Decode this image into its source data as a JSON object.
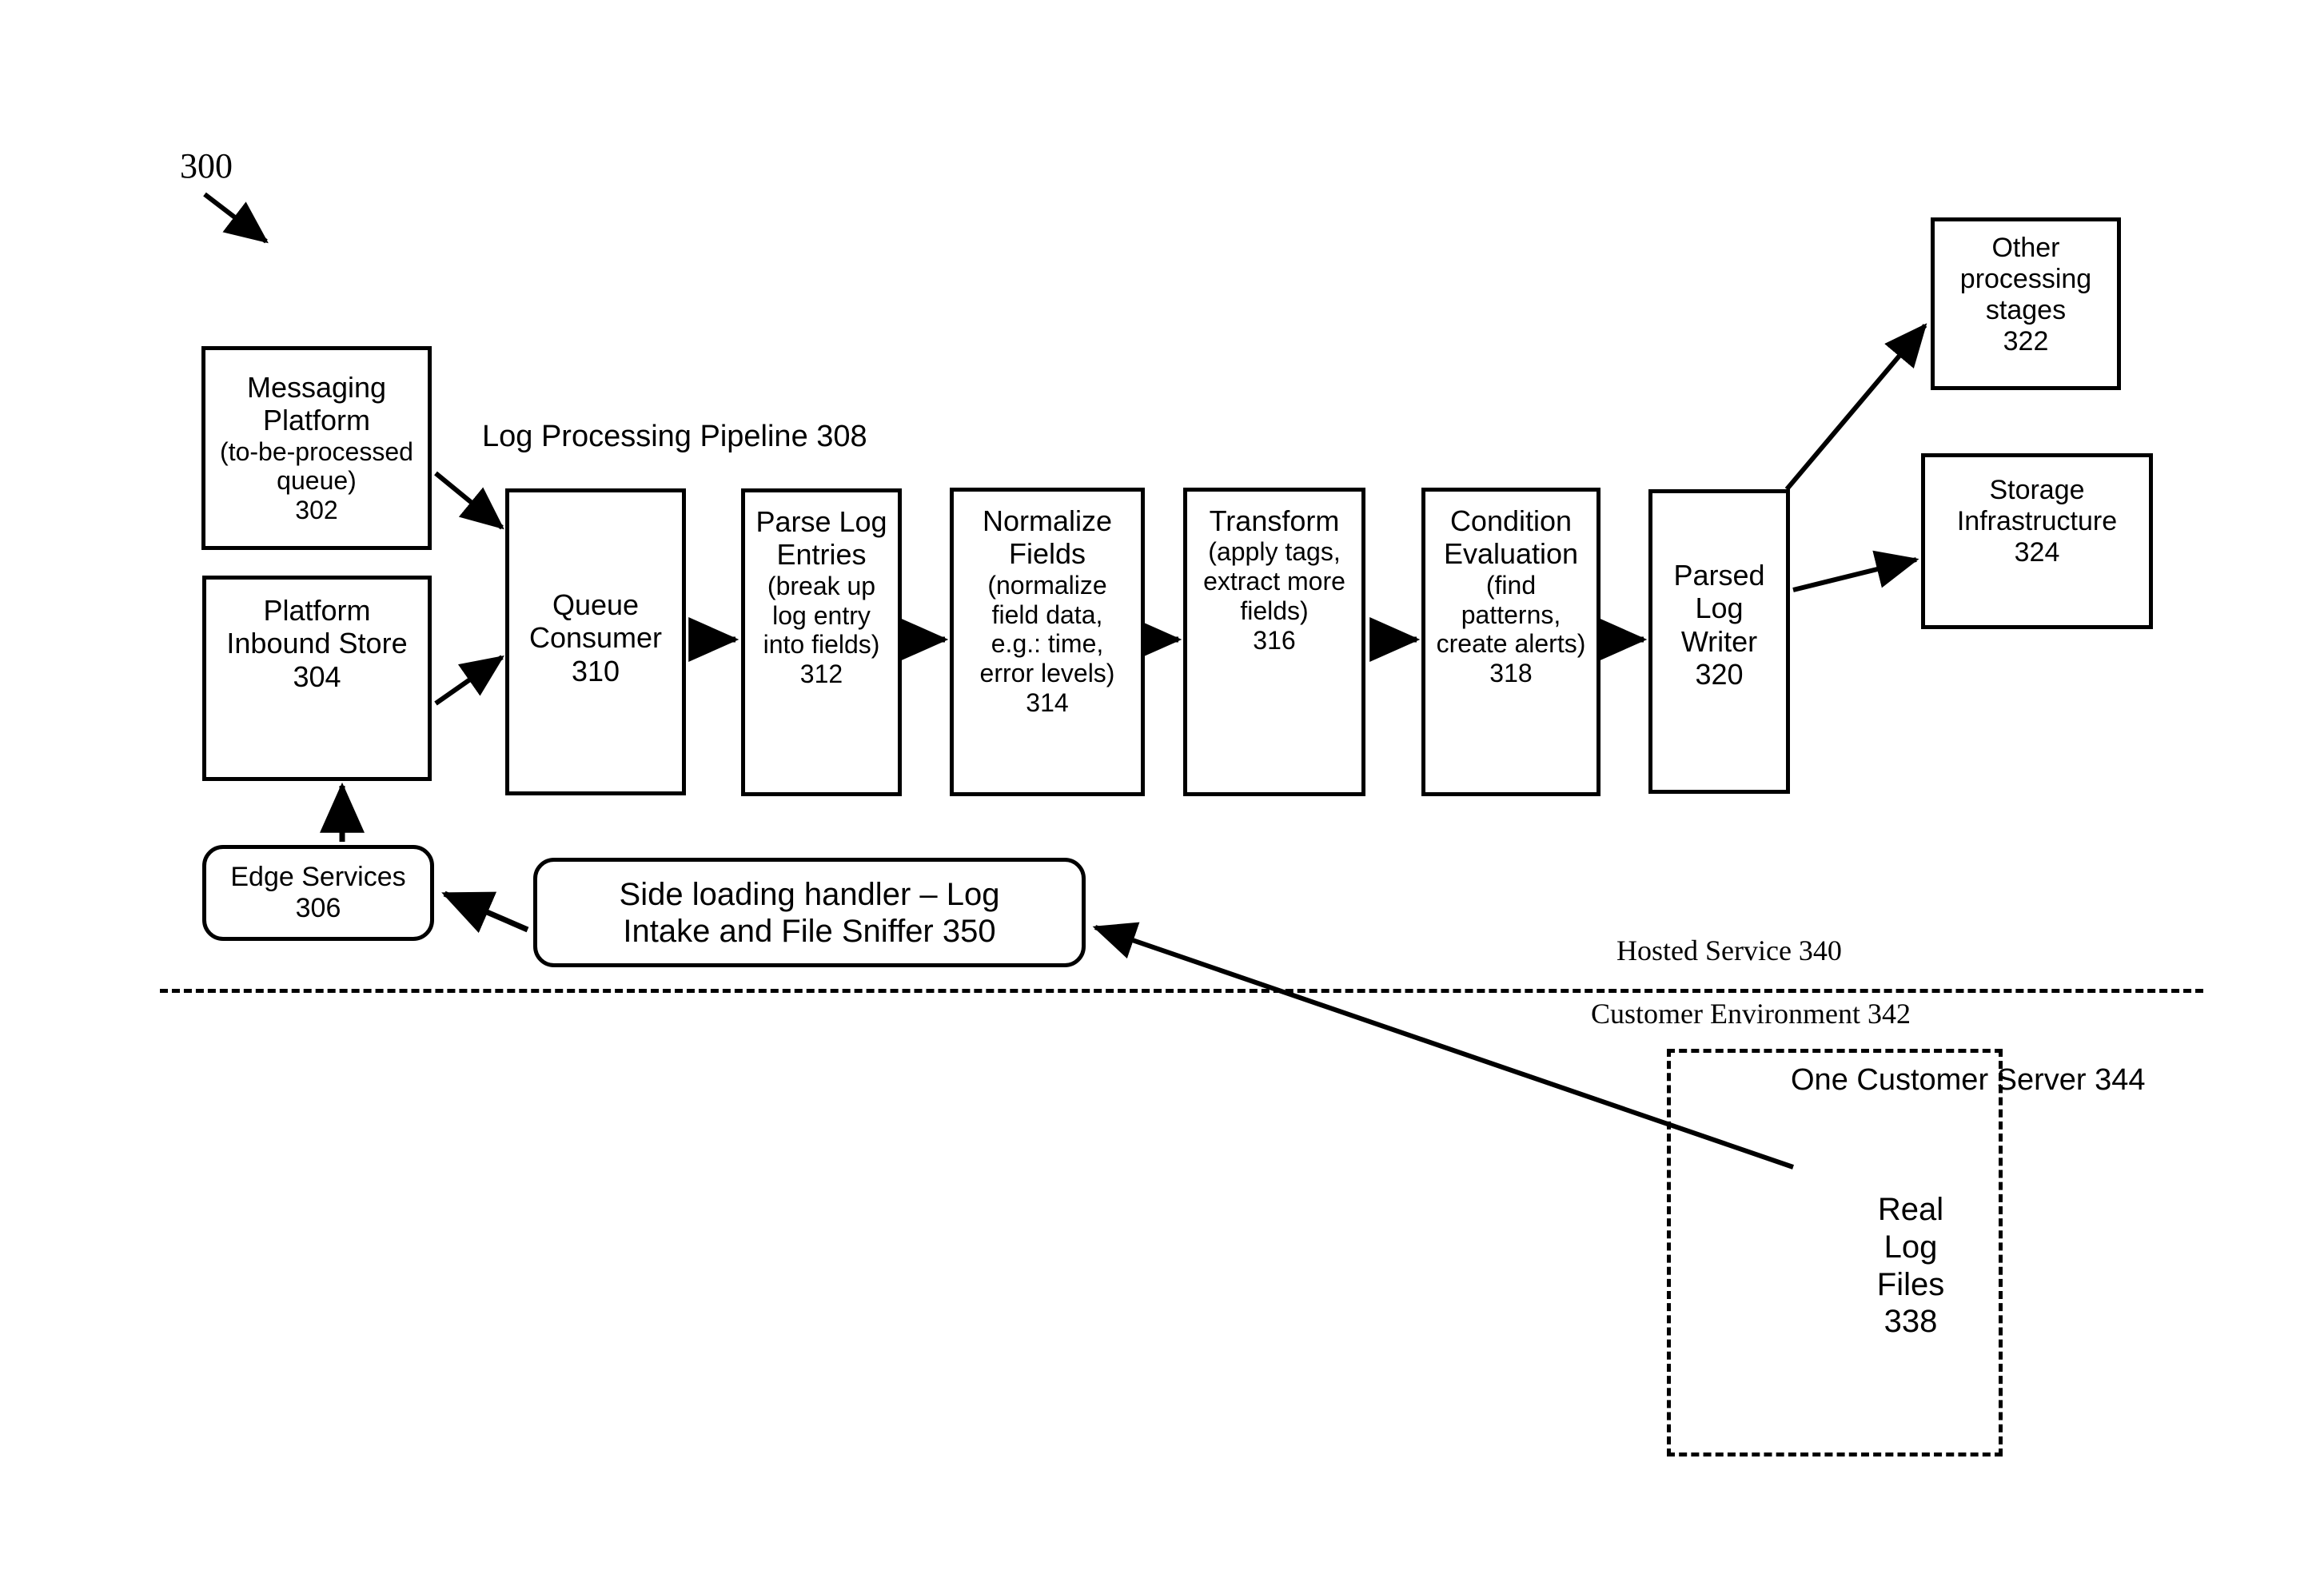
{
  "figure": {
    "number": "300"
  },
  "labels": {
    "pipeline": "Log Processing Pipeline 308",
    "hosted_service": "Hosted Service 340",
    "customer_environment": "Customer Environment 342",
    "customer_server": "One Customer Server 344"
  },
  "nodes": {
    "messaging_platform": {
      "line1": "Messaging",
      "line2": "Platform",
      "line3": "(to-be-processed",
      "line4": "queue)",
      "ref": "302"
    },
    "platform_inbound_store": {
      "line1": "Platform",
      "line2": "Inbound Store",
      "ref": "304"
    },
    "edge_services": {
      "line1": "Edge Services",
      "ref": "306"
    },
    "queue_consumer": {
      "line1": "Queue",
      "line2": "Consumer",
      "ref": "310"
    },
    "parse_log_entries": {
      "line1": "Parse Log",
      "line2": "Entries",
      "line3": "(break up",
      "line4": "log entry",
      "line5": "into fields)",
      "ref": "312"
    },
    "normalize_fields": {
      "line1": "Normalize",
      "line2": "Fields",
      "line3": "(normalize",
      "line4": "field data,",
      "line5": "e.g.: time,",
      "line6": "error levels)",
      "ref": "314"
    },
    "transform": {
      "line1": "Transform",
      "line2": "(apply tags,",
      "line3": "extract more",
      "line4": "fields)",
      "ref": "316"
    },
    "condition_evaluation": {
      "line1": "Condition",
      "line2": "Evaluation",
      "line3": "(find",
      "line4": "patterns,",
      "line5": "create alerts)",
      "ref": "318"
    },
    "parsed_log_writer": {
      "line1": "Parsed",
      "line2": "Log",
      "line3": "Writer",
      "ref": "320"
    },
    "other_processing_stages": {
      "line1": "Other",
      "line2": "processing",
      "line3": "stages",
      "ref": "322"
    },
    "storage_infrastructure": {
      "line1": "Storage",
      "line2": "Infrastructure",
      "ref": "324"
    },
    "side_loading_handler": {
      "line1": "Side loading handler – Log",
      "line2": "Intake and File Sniffer 350"
    },
    "real_log_files": {
      "line1": "Real",
      "line2": "Log",
      "line3": "Files",
      "ref": "338"
    }
  },
  "colors": {
    "stroke": "#000000",
    "background": "#ffffff"
  }
}
